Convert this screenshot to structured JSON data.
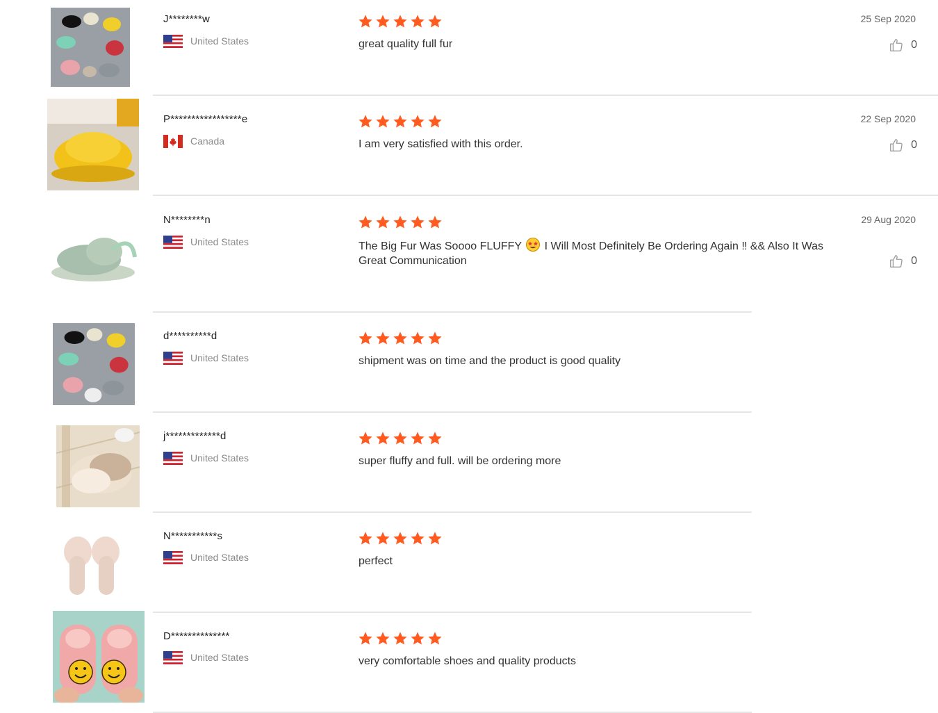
{
  "accent_color": "#ff5a1f",
  "reviews": [
    {
      "user": "J********w",
      "country": "United States",
      "flag": "us",
      "rating": 5,
      "text": "great quality full fur",
      "date": "25 Sep 2020",
      "likes": "0",
      "thumb": "multi-color-slippers"
    },
    {
      "user": "P*****************e",
      "country": "Canada",
      "flag": "ca",
      "rating": 5,
      "text": "I am very satisfied with this order.",
      "date": "22 Sep 2020",
      "likes": "0",
      "thumb": "yellow-slide"
    },
    {
      "user": "N********n",
      "country": "United States",
      "flag": "us",
      "rating": 5,
      "text_before": "The Big Fur Was Soooo FLUFFY",
      "emoji": "star-struck-emoji",
      "text_after": "I Will Most Definitely Be Ordering Again ‼ && Also It Was",
      "text_line2": "Great Communication",
      "date": "29 Aug 2020",
      "likes": "0",
      "thumb": "mint-slingback-slipper"
    },
    {
      "user": "d**********d",
      "country": "United States",
      "flag": "us",
      "rating": 5,
      "text": "shipment was on time and the product is good quality",
      "thumb": "multi-color-slippers"
    },
    {
      "user": "j*************d",
      "country": "United States",
      "flag": "us",
      "rating": 5,
      "text": "super fluffy and full. will be ordering more",
      "thumb": "beige-closed-slippers"
    },
    {
      "user": "N***********s",
      "country": "United States",
      "flag": "us",
      "rating": 5,
      "text": "perfect",
      "thumb": "pink-slides"
    },
    {
      "user": "D**************",
      "country": "United States",
      "flag": "us",
      "rating": 5,
      "text": "very comfortable shoes and quality products",
      "thumb": "smiley-face-slippers"
    }
  ]
}
